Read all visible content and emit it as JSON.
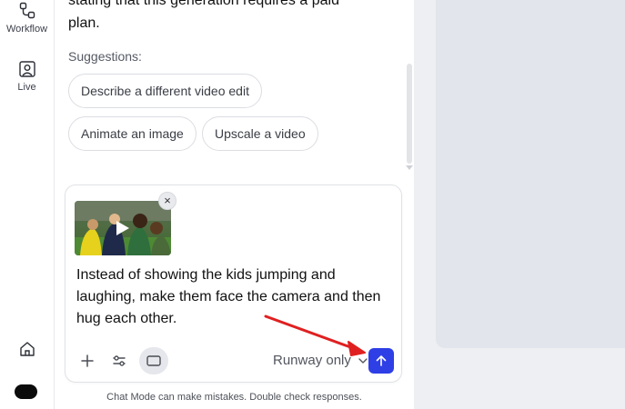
{
  "rail": {
    "workflow_label": "Workflow",
    "live_label": "Live"
  },
  "chat": {
    "message_tail_line1": "stating that this generation requires a paid",
    "message_tail_line2": "plan.",
    "suggestions_label": "Suggestions:",
    "suggestions": [
      "Describe a different video edit",
      "Animate an image",
      "Upscale a video"
    ]
  },
  "composer": {
    "prompt": "Instead of showing the kids jumping and laughing, make them face the camera and then hug each other.",
    "attachment_close": "×",
    "model_label": "Runway only"
  },
  "footer": {
    "disclaimer": "Chat Mode can make mistakes. Double check responses."
  },
  "colors": {
    "send_button": "#2f3fe6",
    "annotation_arrow": "#e02020",
    "right_panel": "#eeeff3"
  }
}
